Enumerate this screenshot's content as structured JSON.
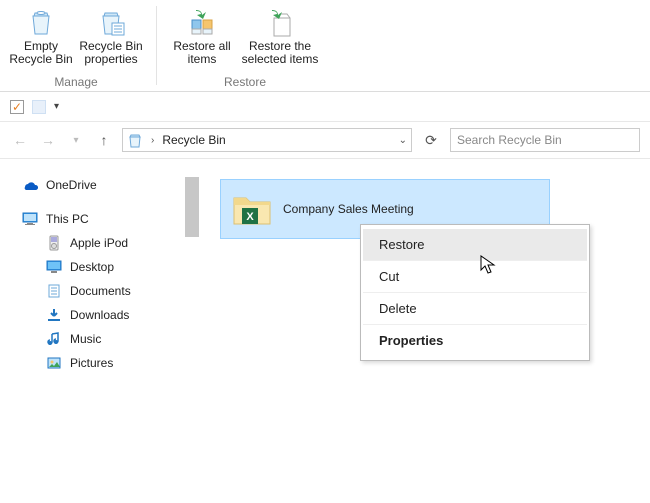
{
  "ribbon": {
    "group1": {
      "title": "Manage",
      "btn1": "Empty Recycle Bin",
      "btn2": "Recycle Bin properties"
    },
    "group2": {
      "title": "Restore",
      "btn1": "Restore all items",
      "btn2": "Restore the selected items"
    }
  },
  "breadcrumb": {
    "location": "Recycle Bin"
  },
  "search": {
    "placeholder": "Search Recycle Bin"
  },
  "sidebar": {
    "onedrive": "OneDrive",
    "thispc": "This PC",
    "items": [
      {
        "label": "Apple iPod"
      },
      {
        "label": "Desktop"
      },
      {
        "label": "Documents"
      },
      {
        "label": "Downloads"
      },
      {
        "label": "Music"
      },
      {
        "label": "Pictures"
      }
    ]
  },
  "file": {
    "name": "Company Sales Meeting"
  },
  "ctx": {
    "restore": "Restore",
    "cut": "Cut",
    "delete": "Delete",
    "properties": "Properties"
  }
}
